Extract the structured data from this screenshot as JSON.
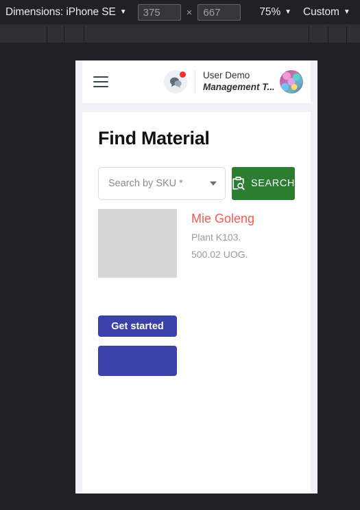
{
  "devtools": {
    "dimensions_label": "Dimensions: iPhone SE",
    "width_value": "375",
    "times_symbol": "×",
    "height_value": "667",
    "zoom_label": "75%",
    "throttle_label": "Custom",
    "caret": "▼",
    "ruler_ticks": [
      68,
      93,
      122,
      450,
      478,
      505
    ]
  },
  "app": {
    "header": {
      "menu_icon": "hamburger-icon",
      "chat_icon": "chat-bubble-icon",
      "notification_dot": true,
      "user_name": "User Demo",
      "user_role": "Management T...",
      "avatar": "user-avatar"
    },
    "page": {
      "title": "Find Material"
    },
    "search": {
      "select_value": "Search by SKU *",
      "select_caret": "chevron-down-icon",
      "button_label": "SEARCH",
      "button_icon": "clipboard-search-icon",
      "button_color": "#2b7d2f"
    },
    "result": {
      "thumbnail": "material-thumbnail",
      "name": "Mie Goleng",
      "plant": "Plant K103.",
      "quantity": "500.02 UOG.",
      "name_color": "#f25c52"
    },
    "actions": {
      "primary_label": "Get started",
      "secondary_label": "",
      "color": "#3b41ab"
    }
  }
}
